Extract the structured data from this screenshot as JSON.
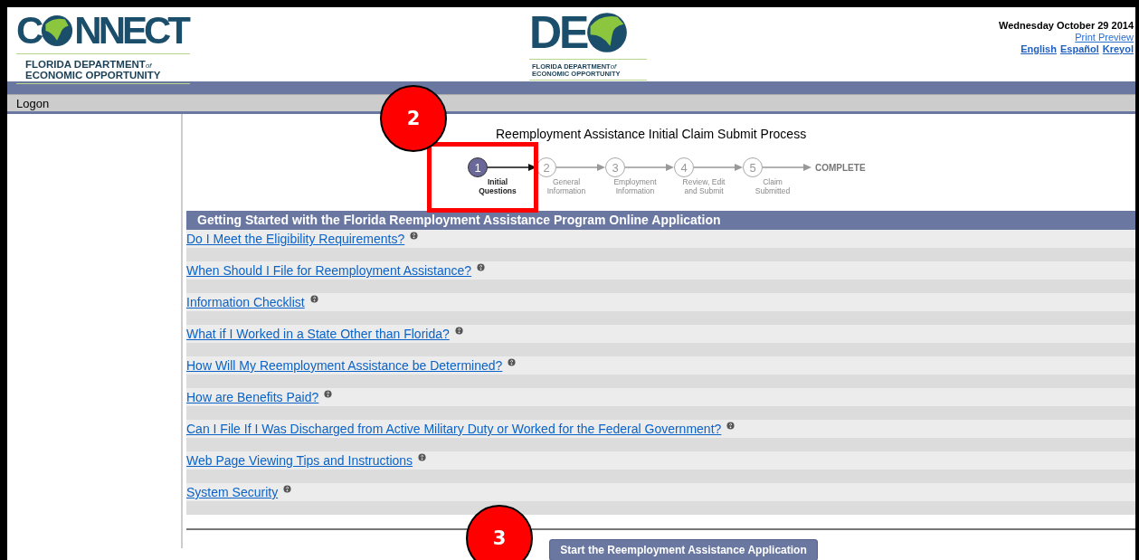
{
  "header": {
    "logo_left": {
      "letters_before": "C",
      "letters_after": "NNECT",
      "subtitle_line1": "FLORIDA DEPARTMENT",
      "subtitle_of": "of",
      "subtitle_line2": "ECONOMIC OPPORTUNITY"
    },
    "logo_center": {
      "letters": "DE",
      "subtitle_line1": "FLORIDA DEPARTMENT",
      "subtitle_of": "of",
      "subtitle_line2": "ECONOMIC OPPORTUNITY"
    },
    "date": "Wednesday October 29 2014",
    "print_preview": "Print Preview",
    "languages": [
      "English",
      "Español",
      "Kreyol"
    ]
  },
  "menu_bar": {
    "item": "Logon"
  },
  "process": {
    "title": "Reemployment Assistance Initial Claim Submit Process",
    "steps": [
      {
        "number": "1",
        "label_lines": [
          "Initial",
          "Questions"
        ],
        "selected": true
      },
      {
        "number": "2",
        "label_lines": [
          "General",
          "Information"
        ],
        "selected": false
      },
      {
        "number": "3",
        "label_lines": [
          "Employment",
          "Information"
        ],
        "selected": false
      },
      {
        "number": "4",
        "label_lines": [
          "Review, Edit",
          "and Submit"
        ],
        "selected": false
      },
      {
        "number": "5",
        "label_lines": [
          "Claim",
          "Submitted"
        ],
        "selected": false
      }
    ],
    "final": "COMPLETE"
  },
  "section": {
    "heading": "Getting Started with the Florida Reemployment Assistance Program Online Application",
    "links": [
      "Do I Meet the Eligibility Requirements?",
      "When Should I File for Reemployment Assistance?",
      "Information Checklist",
      "What if I Worked in a State Other than Florida?",
      "How Will My Reemployment Assistance be Determined?",
      "How are Benefits Paid?",
      "Can I File If I Was Discharged from Active Military Duty or Worked for the Federal Government?",
      "Web Page Viewing Tips and Instructions",
      "System Security"
    ]
  },
  "start_button": "Start the Reemployment Assistance Application",
  "callouts": [
    {
      "number": "2",
      "kind": "step_box"
    },
    {
      "number": "3",
      "kind": "plain"
    }
  ]
}
